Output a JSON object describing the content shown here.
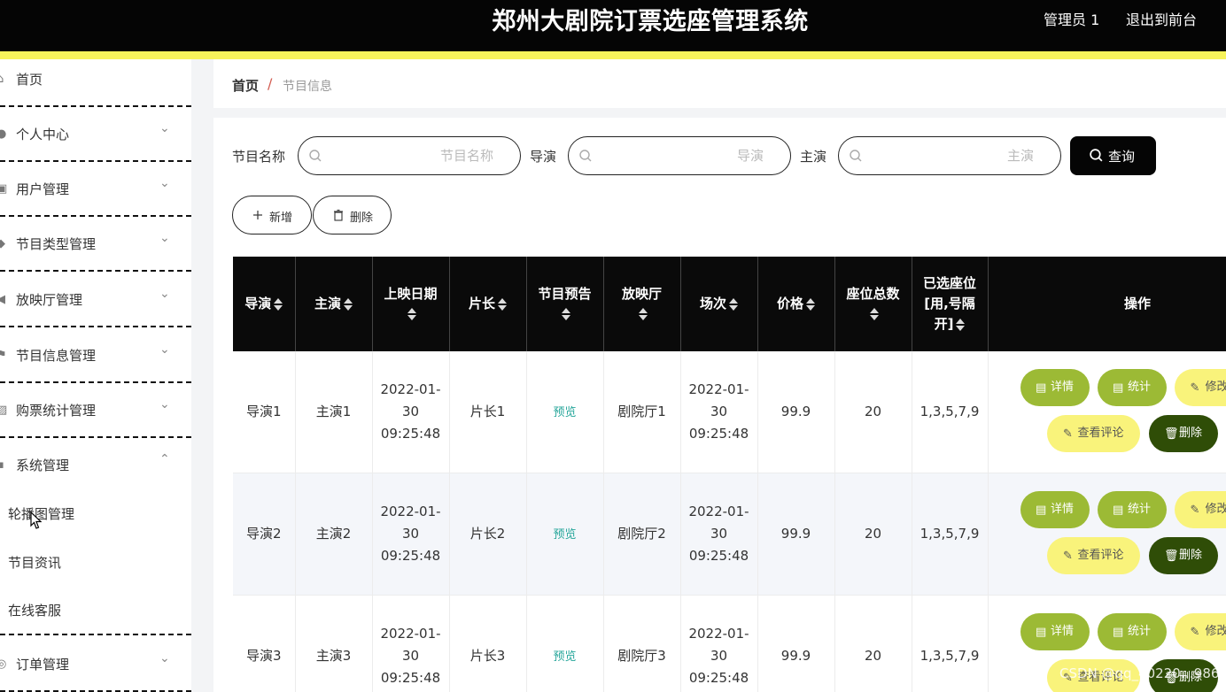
{
  "header": {
    "title": "郑州大剧院订票选座管理系统",
    "admin_name": "管理员 1",
    "logout_label": "退出到前台",
    "accent_color": "#f7f35a"
  },
  "sidebar": {
    "items": [
      {
        "label": "首页",
        "icon": "home-icon",
        "expandable": false
      },
      {
        "label": "个人中心",
        "icon": "user-icon",
        "expandable": true
      },
      {
        "label": "用户管理",
        "icon": "users-icon",
        "expandable": true
      },
      {
        "label": "节目类型管理",
        "icon": "category-icon",
        "expandable": true
      },
      {
        "label": "放映厅管理",
        "icon": "send-icon",
        "expandable": true
      },
      {
        "label": "节目信息管理",
        "icon": "flag-icon",
        "expandable": true
      },
      {
        "label": "购票统计管理",
        "icon": "chart-icon",
        "expandable": true
      },
      {
        "label": "系统管理",
        "icon": "grid-icon",
        "expandable": true,
        "expanded": true
      },
      {
        "label": "订单管理",
        "icon": "order-icon",
        "expandable": true
      }
    ],
    "system_subitems": [
      "轮播图管理",
      "节目资讯",
      "在线客服"
    ]
  },
  "breadcrumb": {
    "home": "首页",
    "separator": "/",
    "current": "节目信息"
  },
  "search": {
    "name_label": "节目名称",
    "name_placeholder": "节目名称",
    "director_label": "导演",
    "director_placeholder": "导演",
    "actor_label": "主演",
    "actor_placeholder": "主演",
    "query_label": "查询"
  },
  "actions": {
    "add_label": "新增",
    "delete_label": "删除"
  },
  "table": {
    "headers": [
      "导演",
      "主演",
      "上映日期",
      "片长",
      "节目预告",
      "放映厅",
      "场次",
      "价格",
      "座位总数",
      "已选座位[用,号隔开]",
      "操作"
    ],
    "rows": [
      {
        "director": "导演1",
        "actor": "主演1",
        "date": "2022-01-30 09:25:48",
        "length": "片长1",
        "trailer": "预览",
        "hall": "剧院厅1",
        "session": "2022-01-30 09:25:48",
        "price": "99.9",
        "seats": "20",
        "selected": "1,3,5,7,9"
      },
      {
        "director": "导演2",
        "actor": "主演2",
        "date": "2022-01-30 09:25:48",
        "length": "片长2",
        "trailer": "预览",
        "hall": "剧院厅2",
        "session": "2022-01-30 09:25:48",
        "price": "99.9",
        "seats": "20",
        "selected": "1,3,5,7,9"
      },
      {
        "director": "导演3",
        "actor": "主演3",
        "date": "2022-01-30 09:25:48",
        "length": "片长3",
        "trailer": "预览",
        "hall": "剧院厅3",
        "session": "2022-01-30 09:25:48",
        "price": "99.9",
        "seats": "20",
        "selected": "1,3,5,7,9"
      }
    ],
    "row_actions": {
      "detail": "详情",
      "stats": "统计",
      "edit": "修改",
      "review": "查看评论",
      "delete": "删除"
    }
  },
  "watermark": "CSDN @qq_40220…986"
}
